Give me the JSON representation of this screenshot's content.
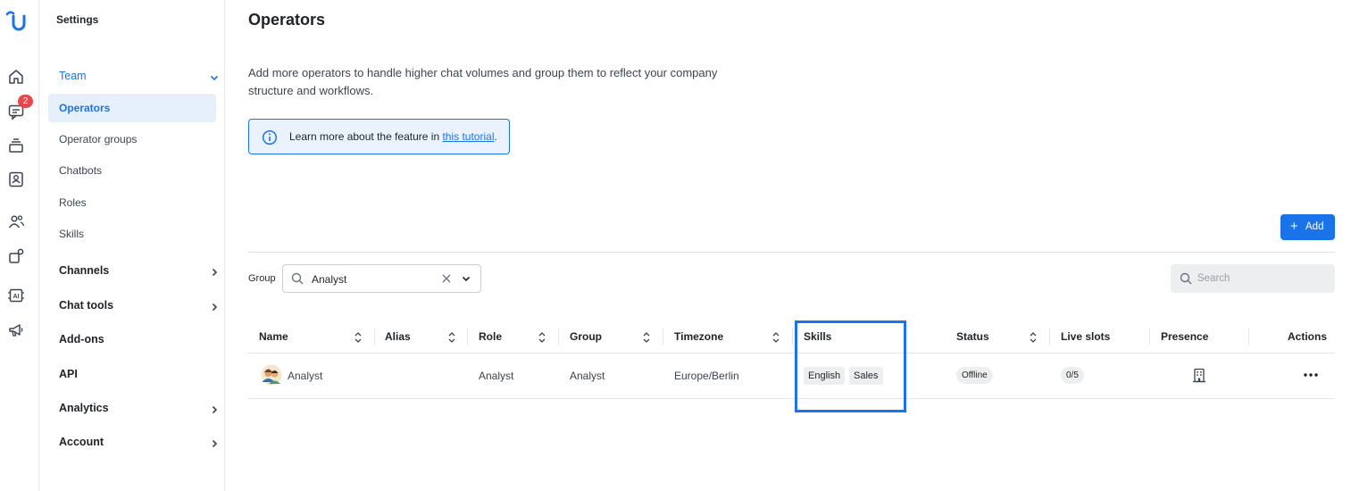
{
  "sidebar": {
    "title": "Settings",
    "team": {
      "label": "Team"
    },
    "team_items": [
      {
        "label": "Operators"
      },
      {
        "label": "Operator groups"
      },
      {
        "label": "Chatbots"
      },
      {
        "label": "Roles"
      },
      {
        "label": "Skills"
      }
    ],
    "groups": [
      {
        "label": "Channels"
      },
      {
        "label": "Chat tools"
      },
      {
        "label": "Add-ons"
      },
      {
        "label": "API"
      },
      {
        "label": "Analytics"
      },
      {
        "label": "Account"
      }
    ]
  },
  "rail": {
    "badge_count": "2",
    "icons": [
      "logo-icon",
      "home-icon",
      "chat-icon",
      "inbox-icon",
      "contacts-icon",
      "team-icon",
      "integrations-icon",
      "ai-icon",
      "campaigns-icon"
    ]
  },
  "main": {
    "title": "Operators",
    "description": "Add more operators to handle higher chat volumes and group them to reflect your company structure and workflows.",
    "info_text": "Learn more about the feature in ",
    "info_link": "this tutorial",
    "info_suffix": ".",
    "add_button": "Add",
    "group_label": "Group",
    "group_value": "Analyst",
    "search_placeholder": "Search"
  },
  "table": {
    "columns": [
      "Name",
      "Alias",
      "Role",
      "Group",
      "Timezone",
      "Skills",
      "Status",
      "Live slots",
      "Presence",
      "Actions"
    ],
    "rows": [
      {
        "name": "Analyst",
        "alias": "",
        "role": "Analyst",
        "group": "Analyst",
        "timezone": "Europe/Berlin",
        "skills": [
          "English",
          "Sales"
        ],
        "status": "Offline",
        "live_slots": "0/5",
        "presence": "building-icon"
      }
    ]
  },
  "colors": {
    "accent": "#1a73e8",
    "badge": "#e5484d",
    "active_bg": "#e6f0fb",
    "info_bg": "#eaf3fd"
  }
}
